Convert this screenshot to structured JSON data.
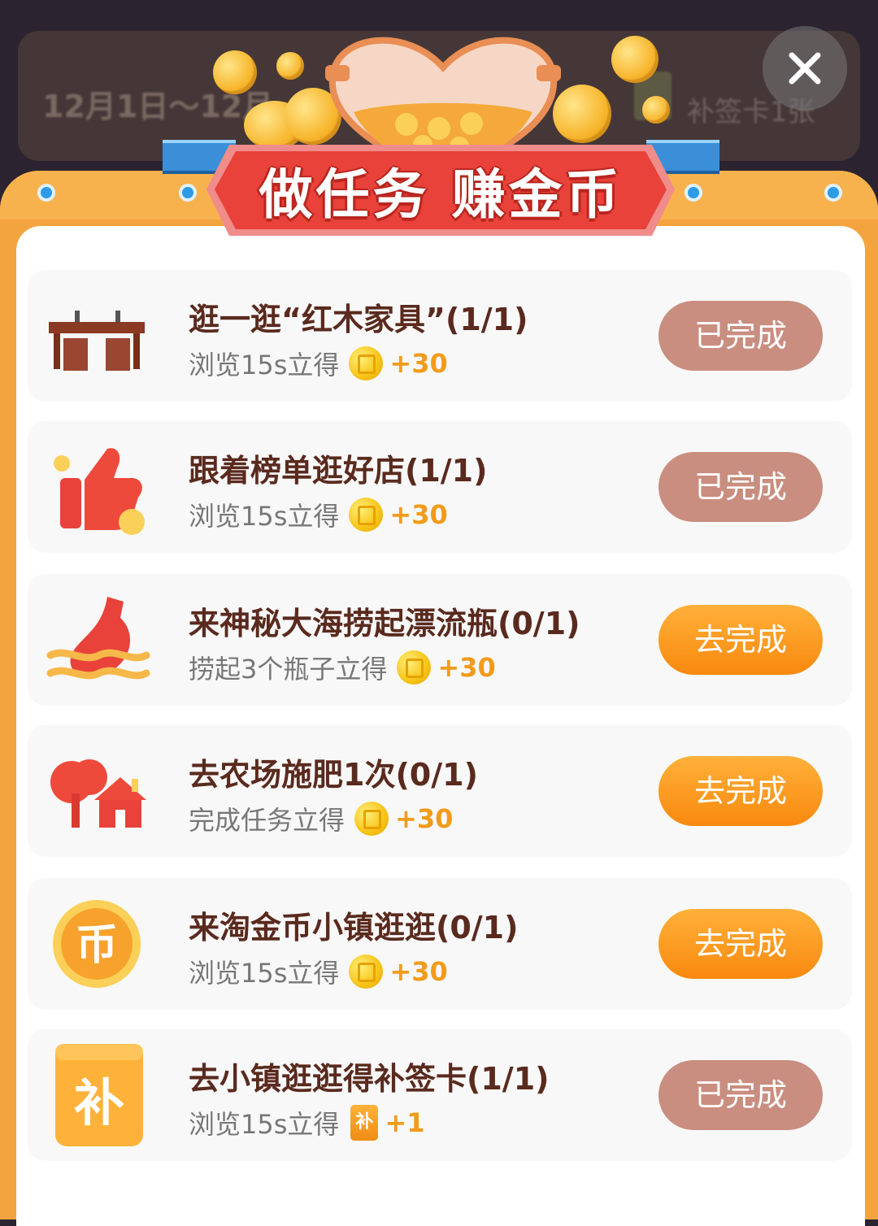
{
  "background": {
    "date_range": "12月1日～12月",
    "card_text": "补签卡1张"
  },
  "header": {
    "title": "做任务 赚金币",
    "close_icon": "close-icon"
  },
  "colors": {
    "frame": "#f4a43f",
    "banner": "#e8423a",
    "done_button": "#c98e80",
    "go_button": "#f9890e",
    "reward": "#f29b1a",
    "title_text": "#5a2a1e"
  },
  "tasks": [
    {
      "title": "逛一逛“红木家具”(1/1)",
      "desc": "浏览15s立得",
      "reward": "+30",
      "reward_icon": "coin-icon",
      "button": "已完成",
      "status": "done",
      "icon": "furniture-icon"
    },
    {
      "title": "跟着榜单逛好店(1/1)",
      "desc": "浏览15s立得",
      "reward": "+30",
      "reward_icon": "coin-icon",
      "button": "已完成",
      "status": "done",
      "icon": "thumbs-up-icon"
    },
    {
      "title": "来神秘大海捞起漂流瓶(0/1)",
      "desc": "捞起3个瓶子立得",
      "reward": "+30",
      "reward_icon": "coin-icon",
      "button": "去完成",
      "status": "todo",
      "icon": "drift-bottle-icon"
    },
    {
      "title": "去农场施肥1次(0/1)",
      "desc": "完成任务立得",
      "reward": "+30",
      "reward_icon": "coin-icon",
      "button": "去完成",
      "status": "todo",
      "icon": "farm-icon"
    },
    {
      "title": "来淘金币小镇逛逛(0/1)",
      "desc": "浏览15s立得",
      "reward": "+30",
      "reward_icon": "coin-icon",
      "button": "去完成",
      "status": "todo",
      "icon": "gold-coin-icon"
    },
    {
      "title": "去小镇逛逛得补签卡(1/1)",
      "desc": "浏览15s立得",
      "reward": "+1",
      "reward_icon": "makeup-card-icon",
      "button": "已完成",
      "status": "done",
      "icon": "makeup-card-icon"
    }
  ],
  "icon_glyphs": {
    "coin": "币",
    "card": "补"
  }
}
